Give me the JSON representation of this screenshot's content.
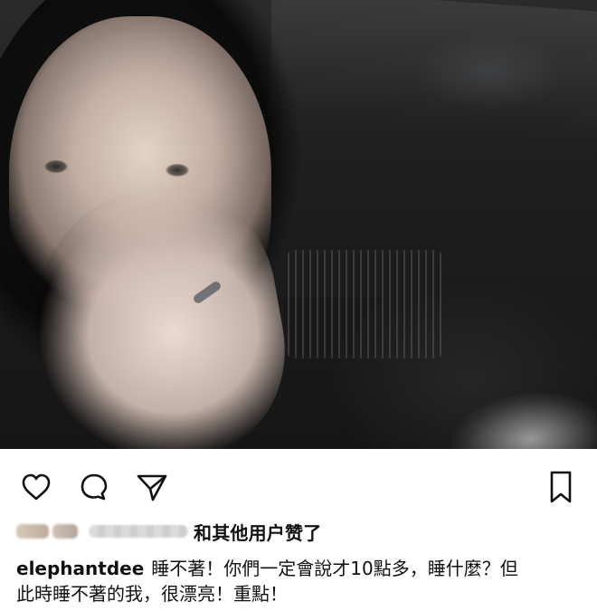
{
  "post": {
    "username": "elephantdee",
    "caption_line_1": "睡不著！你們一定會說才10點多，睡什麼？但",
    "caption_line_2": "此時睡不著的我，很漂亮！重點！",
    "likes_suffix": "和其他用户赞了"
  },
  "actions": {
    "icons": {
      "like": "heart-icon",
      "comment": "comment-icon",
      "share": "paper-plane-icon",
      "save": "bookmark-icon"
    }
  }
}
